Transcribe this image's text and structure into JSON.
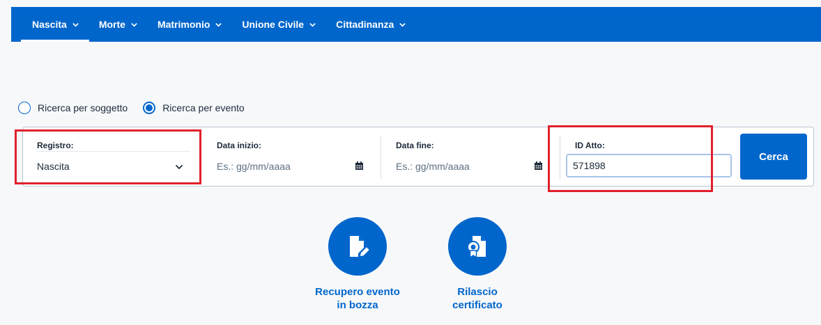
{
  "nav": {
    "tabs": [
      {
        "label": "Nascita",
        "active": true
      },
      {
        "label": "Morte",
        "active": false
      },
      {
        "label": "Matrimonio",
        "active": false
      },
      {
        "label": "Unione Civile",
        "active": false
      },
      {
        "label": "Cittadinanza",
        "active": false
      }
    ]
  },
  "search_mode": {
    "options": [
      {
        "label": "Ricerca per soggetto",
        "checked": false
      },
      {
        "label": "Ricerca per evento",
        "checked": true
      }
    ]
  },
  "filters": {
    "registro": {
      "label": "Registro:",
      "value": "Nascita"
    },
    "data_inizio": {
      "label": "Data inizio:",
      "placeholder": "Es.: gg/mm/aaaa"
    },
    "data_fine": {
      "label": "Data fine:",
      "placeholder": "Es.: gg/mm/aaaa"
    },
    "id_atto": {
      "label": "ID Atto:",
      "value": "571898"
    },
    "submit_label": "Cerca"
  },
  "actions": [
    {
      "label": "Recupero evento\nin bozza",
      "icon": "edit-document-icon"
    },
    {
      "label": "Rilascio\ncertificato",
      "icon": "certificate-icon"
    }
  ],
  "colors": {
    "primary": "#0066cc",
    "highlight": "#e0202c",
    "background": "#f7f8fa"
  }
}
